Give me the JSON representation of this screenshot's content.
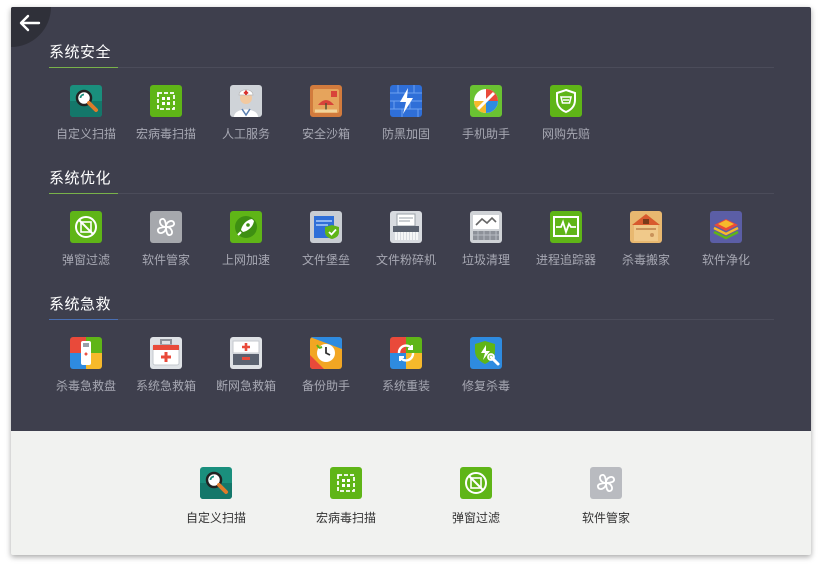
{
  "sections": [
    {
      "title": "系统安全",
      "accent": "#79b24a",
      "items": [
        {
          "label": "自定义扫描",
          "icon": "magnifier-icon"
        },
        {
          "label": "宏病毒扫描",
          "icon": "macro-scan-icon"
        },
        {
          "label": "人工服务",
          "icon": "doctor-icon"
        },
        {
          "label": "安全沙箱",
          "icon": "sandbox-icon"
        },
        {
          "label": "防黑加固",
          "icon": "firewall-bolt-icon"
        },
        {
          "label": "手机助手",
          "icon": "phone-assistant-icon"
        },
        {
          "label": "网购先赔",
          "icon": "shopping-shield-icon"
        }
      ]
    },
    {
      "title": "系统优化",
      "accent": "#79b24a",
      "items": [
        {
          "label": "弹窗过滤",
          "icon": "popup-filter-icon"
        },
        {
          "label": "软件管家",
          "icon": "software-manager-icon"
        },
        {
          "label": "上网加速",
          "icon": "rocket-icon"
        },
        {
          "label": "文件堡垒",
          "icon": "file-fortress-icon"
        },
        {
          "label": "文件粉碎机",
          "icon": "shredder-icon"
        },
        {
          "label": "垃圾清理",
          "icon": "cleanup-icon"
        },
        {
          "label": "进程追踪器",
          "icon": "process-tracker-icon"
        },
        {
          "label": "杀毒搬家",
          "icon": "house-icon"
        },
        {
          "label": "软件净化",
          "icon": "layers-icon"
        }
      ]
    },
    {
      "title": "系统急救",
      "accent": "#4a6fb2",
      "items": [
        {
          "label": "杀毒急救盘",
          "icon": "usb-rescue-icon"
        },
        {
          "label": "系统急救箱",
          "icon": "first-aid-kit-icon"
        },
        {
          "label": "断网急救箱",
          "icon": "network-aid-icon"
        },
        {
          "label": "备份助手",
          "icon": "backup-icon"
        },
        {
          "label": "系统重装",
          "icon": "reinstall-icon"
        },
        {
          "label": "修复杀毒",
          "icon": "repair-shield-icon"
        }
      ]
    }
  ],
  "shortcuts": [
    {
      "label": "自定义扫描",
      "icon": "magnifier-icon"
    },
    {
      "label": "宏病毒扫描",
      "icon": "macro-scan-icon"
    },
    {
      "label": "弹窗过滤",
      "icon": "popup-filter-icon"
    },
    {
      "label": "软件管家",
      "icon": "software-manager-icon"
    }
  ],
  "back_icon": "arrow-left-icon"
}
